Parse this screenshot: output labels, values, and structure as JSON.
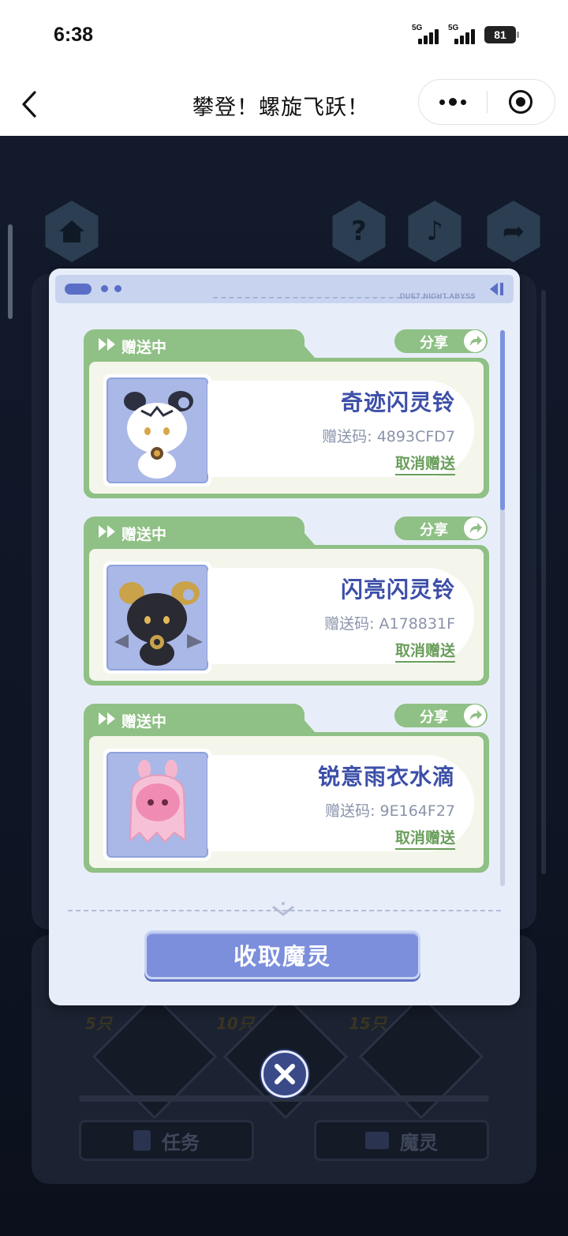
{
  "status_bar": {
    "time": "6:38",
    "signal_1_label": "5G",
    "signal_2_label": "5G",
    "battery": "81"
  },
  "nav": {
    "title": "攀登！螺旋飞跃！"
  },
  "game_background": {
    "top_buttons": [
      "home-icon",
      "help-icon",
      "music-icon",
      "share-icon"
    ],
    "milestones": [
      "5只",
      "10只",
      "15只"
    ],
    "tabs": [
      "任务",
      "魔灵"
    ]
  },
  "dialog": {
    "header_brand": "DUET NIGHT ABYSS",
    "items": [
      {
        "status": "赠送中",
        "share": "分享",
        "name": "奇迹闪灵铃",
        "code": "赠送码: 4893CFD7",
        "cancel": "取消赠送",
        "creature": "white-goat"
      },
      {
        "status": "赠送中",
        "share": "分享",
        "name": "闪亮闪灵铃",
        "code": "赠送码: A178831F",
        "cancel": "取消赠送",
        "creature": "black-goat"
      },
      {
        "status": "赠送中",
        "share": "分享",
        "name": "锐意雨衣水滴",
        "code": "赠送码: 9E164F27",
        "cancel": "取消赠送",
        "creature": "pink-droplet"
      }
    ],
    "collect_button": "收取魔灵"
  },
  "colors": {
    "accent_blue": "#7c8fdc",
    "card_green": "#8fc085",
    "name_blue": "#3d4fa8",
    "cancel_green": "#6a9e5b"
  }
}
